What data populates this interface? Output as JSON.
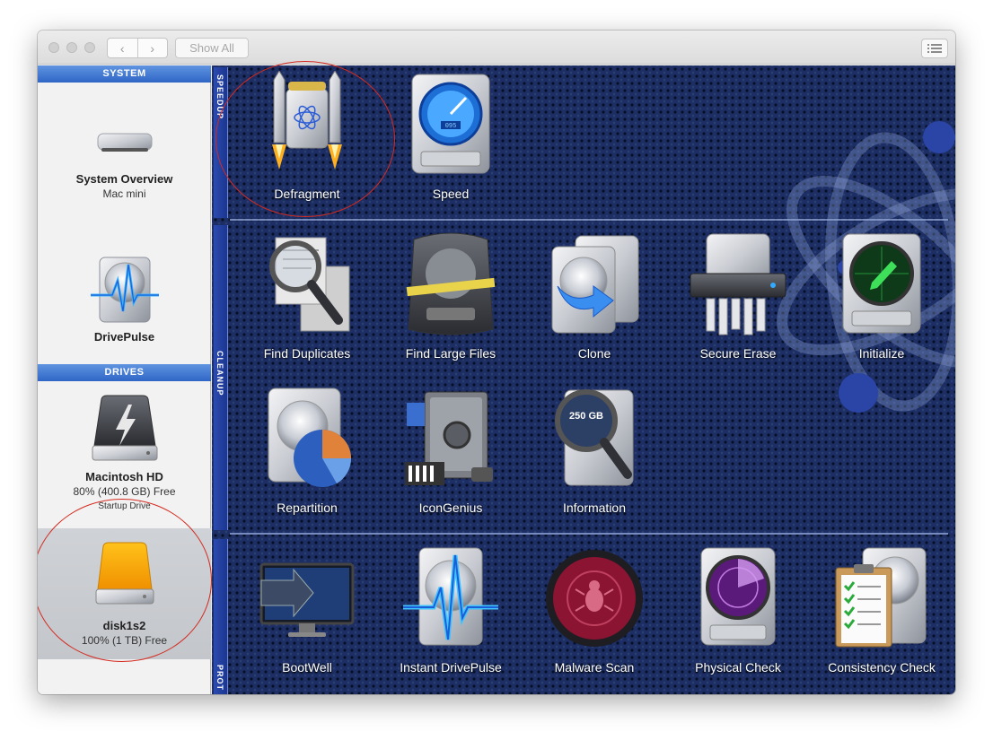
{
  "titlebar": {
    "back": "‹",
    "forward": "›",
    "show_all": "Show All"
  },
  "sidebar": {
    "system_header": "SYSTEM",
    "drives_header": "DRIVES",
    "system_overview": {
      "name": "System Overview",
      "sub": "Mac mini"
    },
    "drivepulse": {
      "name": "DrivePulse"
    },
    "macintosh_hd": {
      "name": "Macintosh HD",
      "free": "80% (400.8 GB) Free",
      "role": "Startup Drive"
    },
    "disk1s2": {
      "name": "disk1s2",
      "free": "100% (1 TB) Free"
    }
  },
  "sections": {
    "speedup": "SPEEDUP",
    "cleanup": "CLEANUP",
    "protect": "PROT"
  },
  "tools": {
    "defragment": "Defragment",
    "speed": "Speed",
    "find_duplicates": "Find Duplicates",
    "find_large_files": "Find Large Files",
    "clone": "Clone",
    "secure_erase": "Secure Erase",
    "initialize": "Initialize",
    "repartition": "Repartition",
    "icongenius": "IconGenius",
    "information": "Information",
    "bootwell": "BootWell",
    "instant_drivepulse": "Instant DrivePulse",
    "malware_scan": "Malware Scan",
    "physical_check": "Physical Check",
    "consistency_check": "Consistency Check"
  },
  "icon_text": {
    "speed_gauge": "095",
    "info_label": "250 GB"
  },
  "colors": {
    "header_blue": "#2f66c6",
    "panel_bg": "#1c2e63",
    "annotation_red": "#d42a1f",
    "external_drive": "#f5a800"
  }
}
